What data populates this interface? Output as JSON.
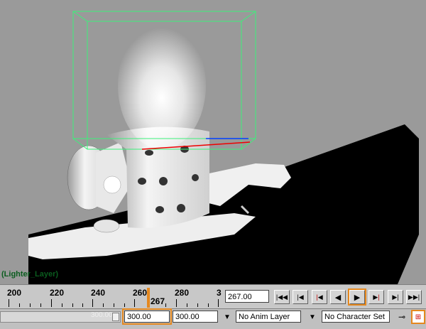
{
  "viewport": {
    "layer_label": "(Lighter_Layer)"
  },
  "time_slider": {
    "ticks": [
      "200",
      "220",
      "240",
      "260",
      "280",
      "3"
    ],
    "current_frame_label": "267",
    "current_time": "267.00",
    "playback_buttons": [
      {
        "name": "go-to-start-button",
        "icon": "skip-back-icon",
        "glyph": "|◀◀"
      },
      {
        "name": "step-back-frame-button",
        "icon": "step-back-icon",
        "glyph": "|◀"
      },
      {
        "name": "step-back-key-button",
        "icon": "step-back-key-icon",
        "glyph": "|◀"
      },
      {
        "name": "play-backwards-button",
        "icon": "play-back-icon",
        "glyph": "◀"
      },
      {
        "name": "play-forwards-button",
        "icon": "play-icon",
        "glyph": "▶"
      },
      {
        "name": "step-forward-key-button",
        "icon": "step-forward-key-icon",
        "glyph": "▶|"
      },
      {
        "name": "step-forward-frame-button",
        "icon": "step-forward-icon",
        "glyph": "▶|"
      },
      {
        "name": "go-to-end-button",
        "icon": "skip-forward-icon",
        "glyph": "▶▶|"
      }
    ]
  },
  "range_slider": {
    "handle_text": "300.00",
    "end_time": "300.00",
    "max_time": "300.00",
    "anim_layer": "No Anim Layer",
    "character_set": "No Character Set"
  },
  "colors": {
    "highlight": "#e5881e",
    "viewport_bg": "#9a9a9a",
    "layer_label": "#0a5c1e"
  }
}
